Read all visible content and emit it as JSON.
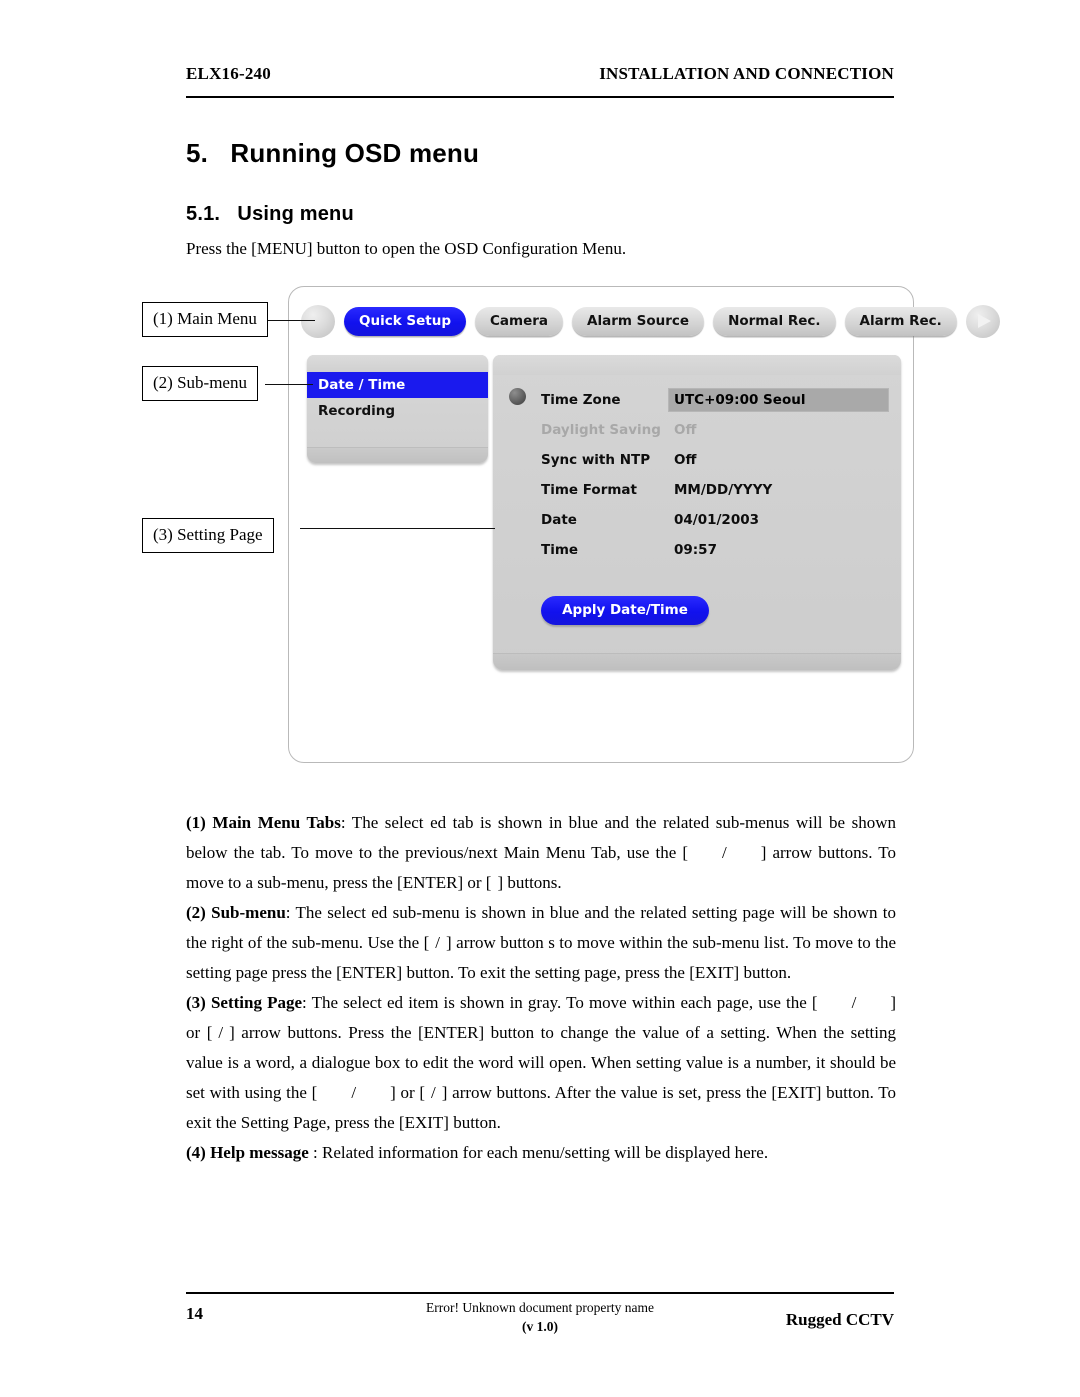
{
  "header": {
    "left": "ELX16-240",
    "right": "INSTALLATION AND CONNECTION"
  },
  "headings": {
    "section": "5.   Running OSD menu",
    "subsection": "5.1.   Using menu",
    "intro": "Press the [MENU] button to open the OSD Configuration Menu."
  },
  "figure": {
    "callouts": [
      {
        "label": "(1) Main Menu"
      },
      {
        "label": "(2) Sub-menu"
      },
      {
        "label": "(3) Setting Page"
      }
    ],
    "osd": {
      "tabs": [
        {
          "label": "Quick Setup",
          "active": true
        },
        {
          "label": "Camera",
          "active": false
        },
        {
          "label": "Alarm Source",
          "active": false
        },
        {
          "label": "Normal Rec.",
          "active": false
        },
        {
          "label": "Alarm Rec.",
          "active": false
        }
      ],
      "nav": {
        "prev_icon": "circle-button-icon",
        "next_icon": "play-arrow-right-icon"
      },
      "submenu": [
        {
          "label": "Date / Time",
          "active": true
        },
        {
          "label": "Recording",
          "active": false
        }
      ],
      "settings": {
        "rows": [
          {
            "label": "Time Zone",
            "value": "UTC+09:00 Seoul",
            "state": "selected"
          },
          {
            "label": "Daylight Saving",
            "value": "Off",
            "state": "disabled"
          },
          {
            "label": "Sync with NTP",
            "value": "Off",
            "state": "normal"
          },
          {
            "label": "Time Format",
            "value": "MM/DD/YYYY",
            "state": "normal"
          },
          {
            "label": "Date",
            "value": "04/01/2003",
            "state": "normal"
          },
          {
            "label": "Time",
            "value": "09:57",
            "state": "normal"
          }
        ],
        "apply_button": "Apply Date/Time"
      },
      "colors": {
        "accent_blue": "#1a1aee",
        "panel_gray": "#d2d2d2",
        "selected_value_gray": "#a9a9a9",
        "disabled_text": "#a8a8a8"
      }
    }
  },
  "body": {
    "p1_num": "(1)",
    "p1_bold": "Main Menu",
    "p1_bold2": "Tabs",
    "p1_a": ": The select ed tab is  shown  in  blue and  the  related sub-menus will be shown below the tab. To move to the previous/next Main Menu Tab, use the [",
    "p1_b": "/",
    "p1_c": "] arrow buttons. To move to a sub-menu, press the [ENTER] or [",
    "p1_d": "] buttons.",
    "p2_num": "(2)",
    "p2_bold": "Sub-menu",
    "p2_a": ": The select ed sub-menu is  shown  in blue and the related setting page  will be shown to the right of the sub-menu. Use the [",
    "p2_b": "/",
    "p2_c": "] arrow button s to move within the sub-menu list. To move to the setting page press the [ENTER] button. To exit the setting page, press the [EXIT] button.",
    "p3_num": "(3)",
    "p3_bold": "Setting  Page",
    "p3_a": ": The select ed item is shown in gray. To move within each page, use the [",
    "p3_b": "/",
    "p3_c": "] or [",
    "p3_d": "/",
    "p3_e": "] arrow buttons. Press the [ENTER] button to change the value of a setting. When the setting value is a word, a dialogue  box to edit the word will  open.  When setting value is a number,  it should be set with using the [",
    "p3_f": "/",
    "p3_g": "] or [",
    "p3_h": "/",
    "p3_i": "] arrow buttons. After the value is set, press the [EXIT] button. To exit the Setting Page, press the [EXIT] button.",
    "p4_num": "(4)",
    "p4_bold": "Help message",
    "p4_a": " : Related information for each menu/setting will be displayed here."
  },
  "footer": {
    "page_number": "14",
    "center_line1": "Error! Unknown document property name",
    "center_line2": "(v 1.0)",
    "right": "Rugged CCTV"
  }
}
